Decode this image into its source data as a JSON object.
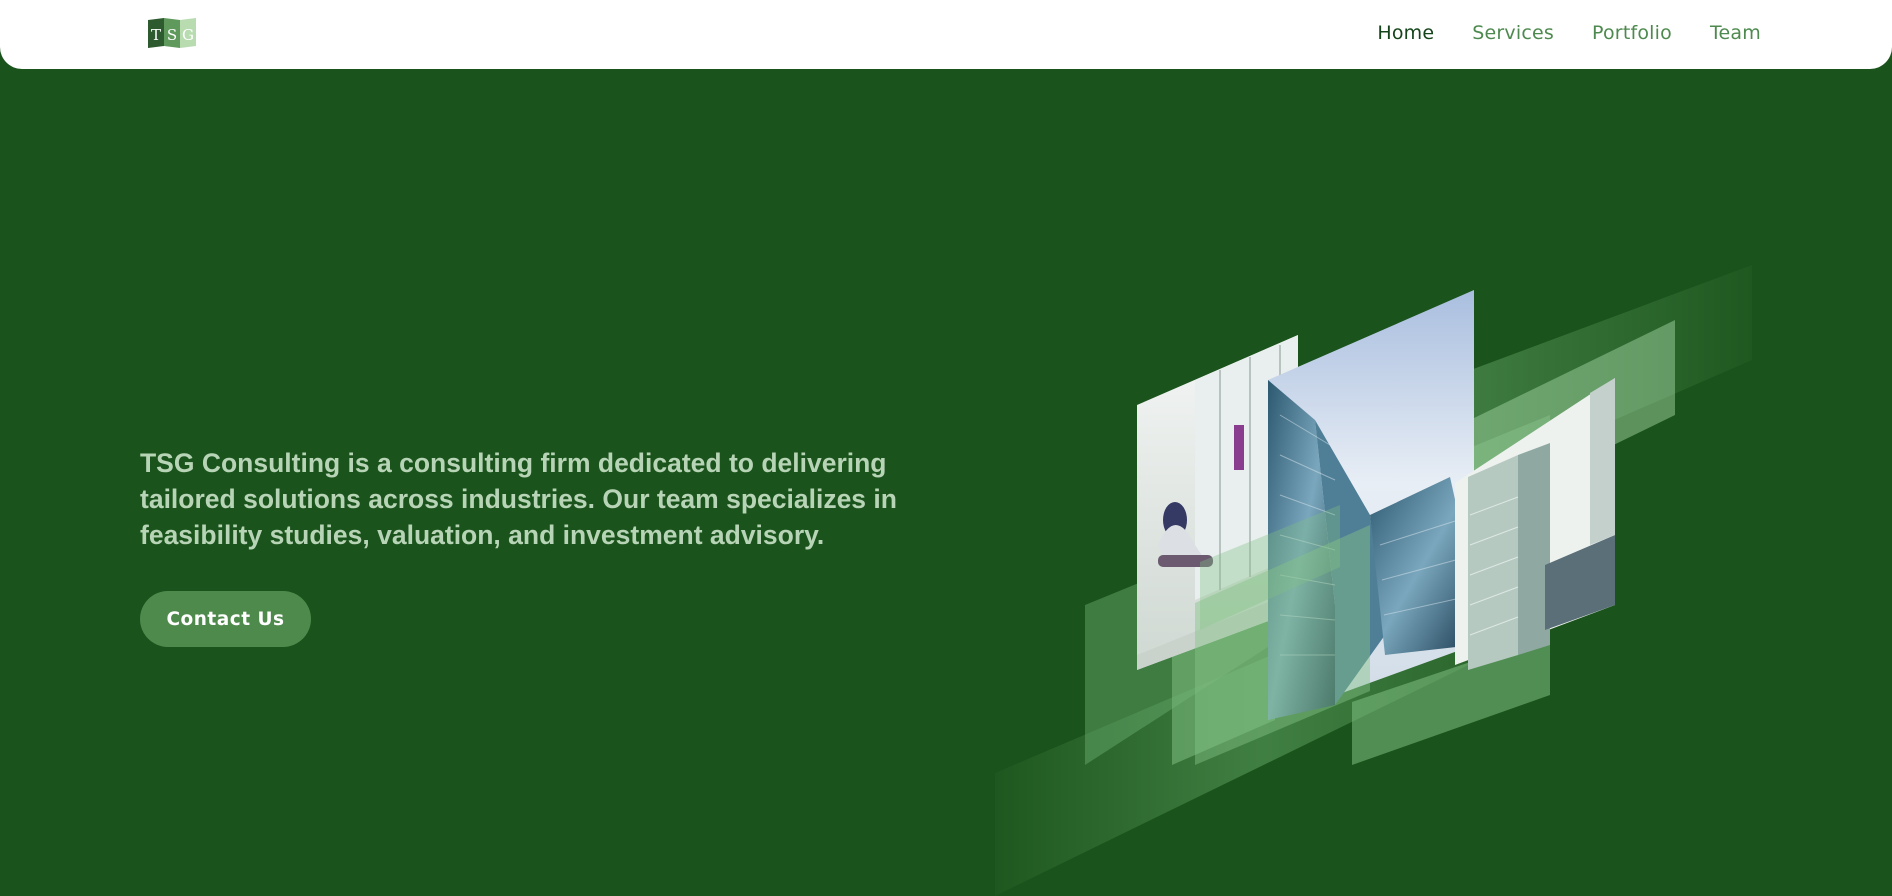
{
  "header": {
    "logo_text": "TSG",
    "nav": [
      {
        "label": "Home",
        "active": true
      },
      {
        "label": "Services",
        "active": false
      },
      {
        "label": "Portfolio",
        "active": false
      },
      {
        "label": "Team",
        "active": false
      }
    ]
  },
  "hero": {
    "description": "TSG Consulting is a consulting firm dedicated to delivering tailored solutions across industries. Our team specializes in feasibility studies, valuation, and investment advisory.",
    "cta_label": "Contact Us"
  },
  "colors": {
    "background": "#1a531b",
    "navbar": "#ffffff",
    "nav_link": "#4e8a4f",
    "nav_active": "#16441a",
    "hero_text": "#b8d4b6",
    "button": "#4f8a4d"
  }
}
